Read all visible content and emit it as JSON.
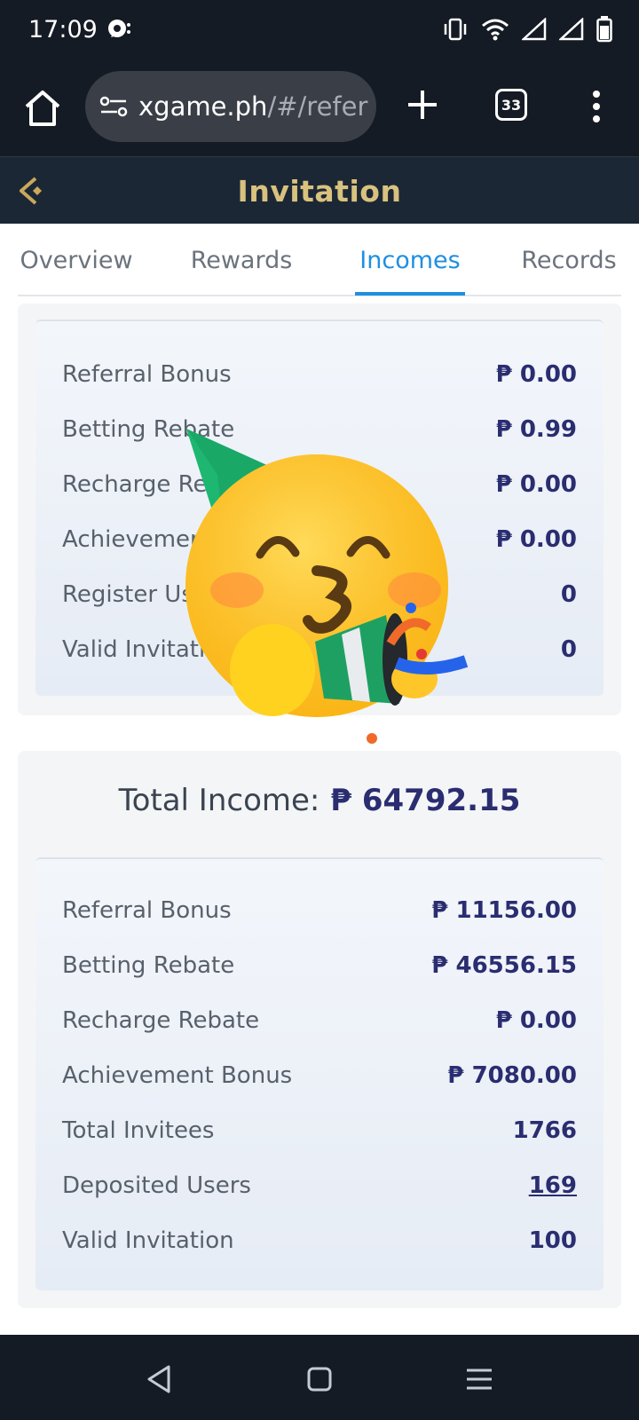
{
  "status": {
    "time": "17:09",
    "icons": [
      "chat-notification-icon",
      "vibrate-icon",
      "wifi-icon",
      "signal-icon",
      "signal-icon",
      "battery-icon"
    ]
  },
  "browser": {
    "url_host": "xgame.ph",
    "url_path": "/#/refer",
    "tab_count": "33"
  },
  "header": {
    "title": "Invitation"
  },
  "tabs": [
    {
      "label": "Overview"
    },
    {
      "label": "Rewards"
    },
    {
      "label": "Incomes"
    },
    {
      "label": "Records"
    }
  ],
  "active_tab": "Incomes",
  "card1": {
    "rows": [
      {
        "label": "Referral Bonus",
        "value": "₱ 0.00"
      },
      {
        "label": "Betting Rebate",
        "value": "₱ 0.99"
      },
      {
        "label": "Recharge Rebate",
        "value": "₱ 0.00"
      },
      {
        "label": "Achievement Bonus",
        "value": "₱ 0.00"
      },
      {
        "label": "Register Users",
        "value": "0"
      },
      {
        "label": "Valid Invitation",
        "value": "0"
      }
    ]
  },
  "card2": {
    "total_label": "Total Income:",
    "total_value": "₱ 64792.15",
    "rows": [
      {
        "label": "Referral Bonus",
        "value": "₱ 11156.00"
      },
      {
        "label": "Betting Rebate",
        "value": "₱ 46556.15"
      },
      {
        "label": "Recharge Rebate",
        "value": "₱ 0.00"
      },
      {
        "label": "Achievement Bonus",
        "value": "₱ 7080.00"
      },
      {
        "label": "Total Invitees",
        "value": "1766"
      },
      {
        "label": "Deposited Users",
        "value": "169"
      },
      {
        "label": "Valid Invitation",
        "value": "100"
      }
    ]
  },
  "colors": {
    "accent_blue": "#1f8fe0",
    "value_navy": "#2a2d70",
    "title_gold": "#d9c27e",
    "header_bg": "#1c2736"
  }
}
